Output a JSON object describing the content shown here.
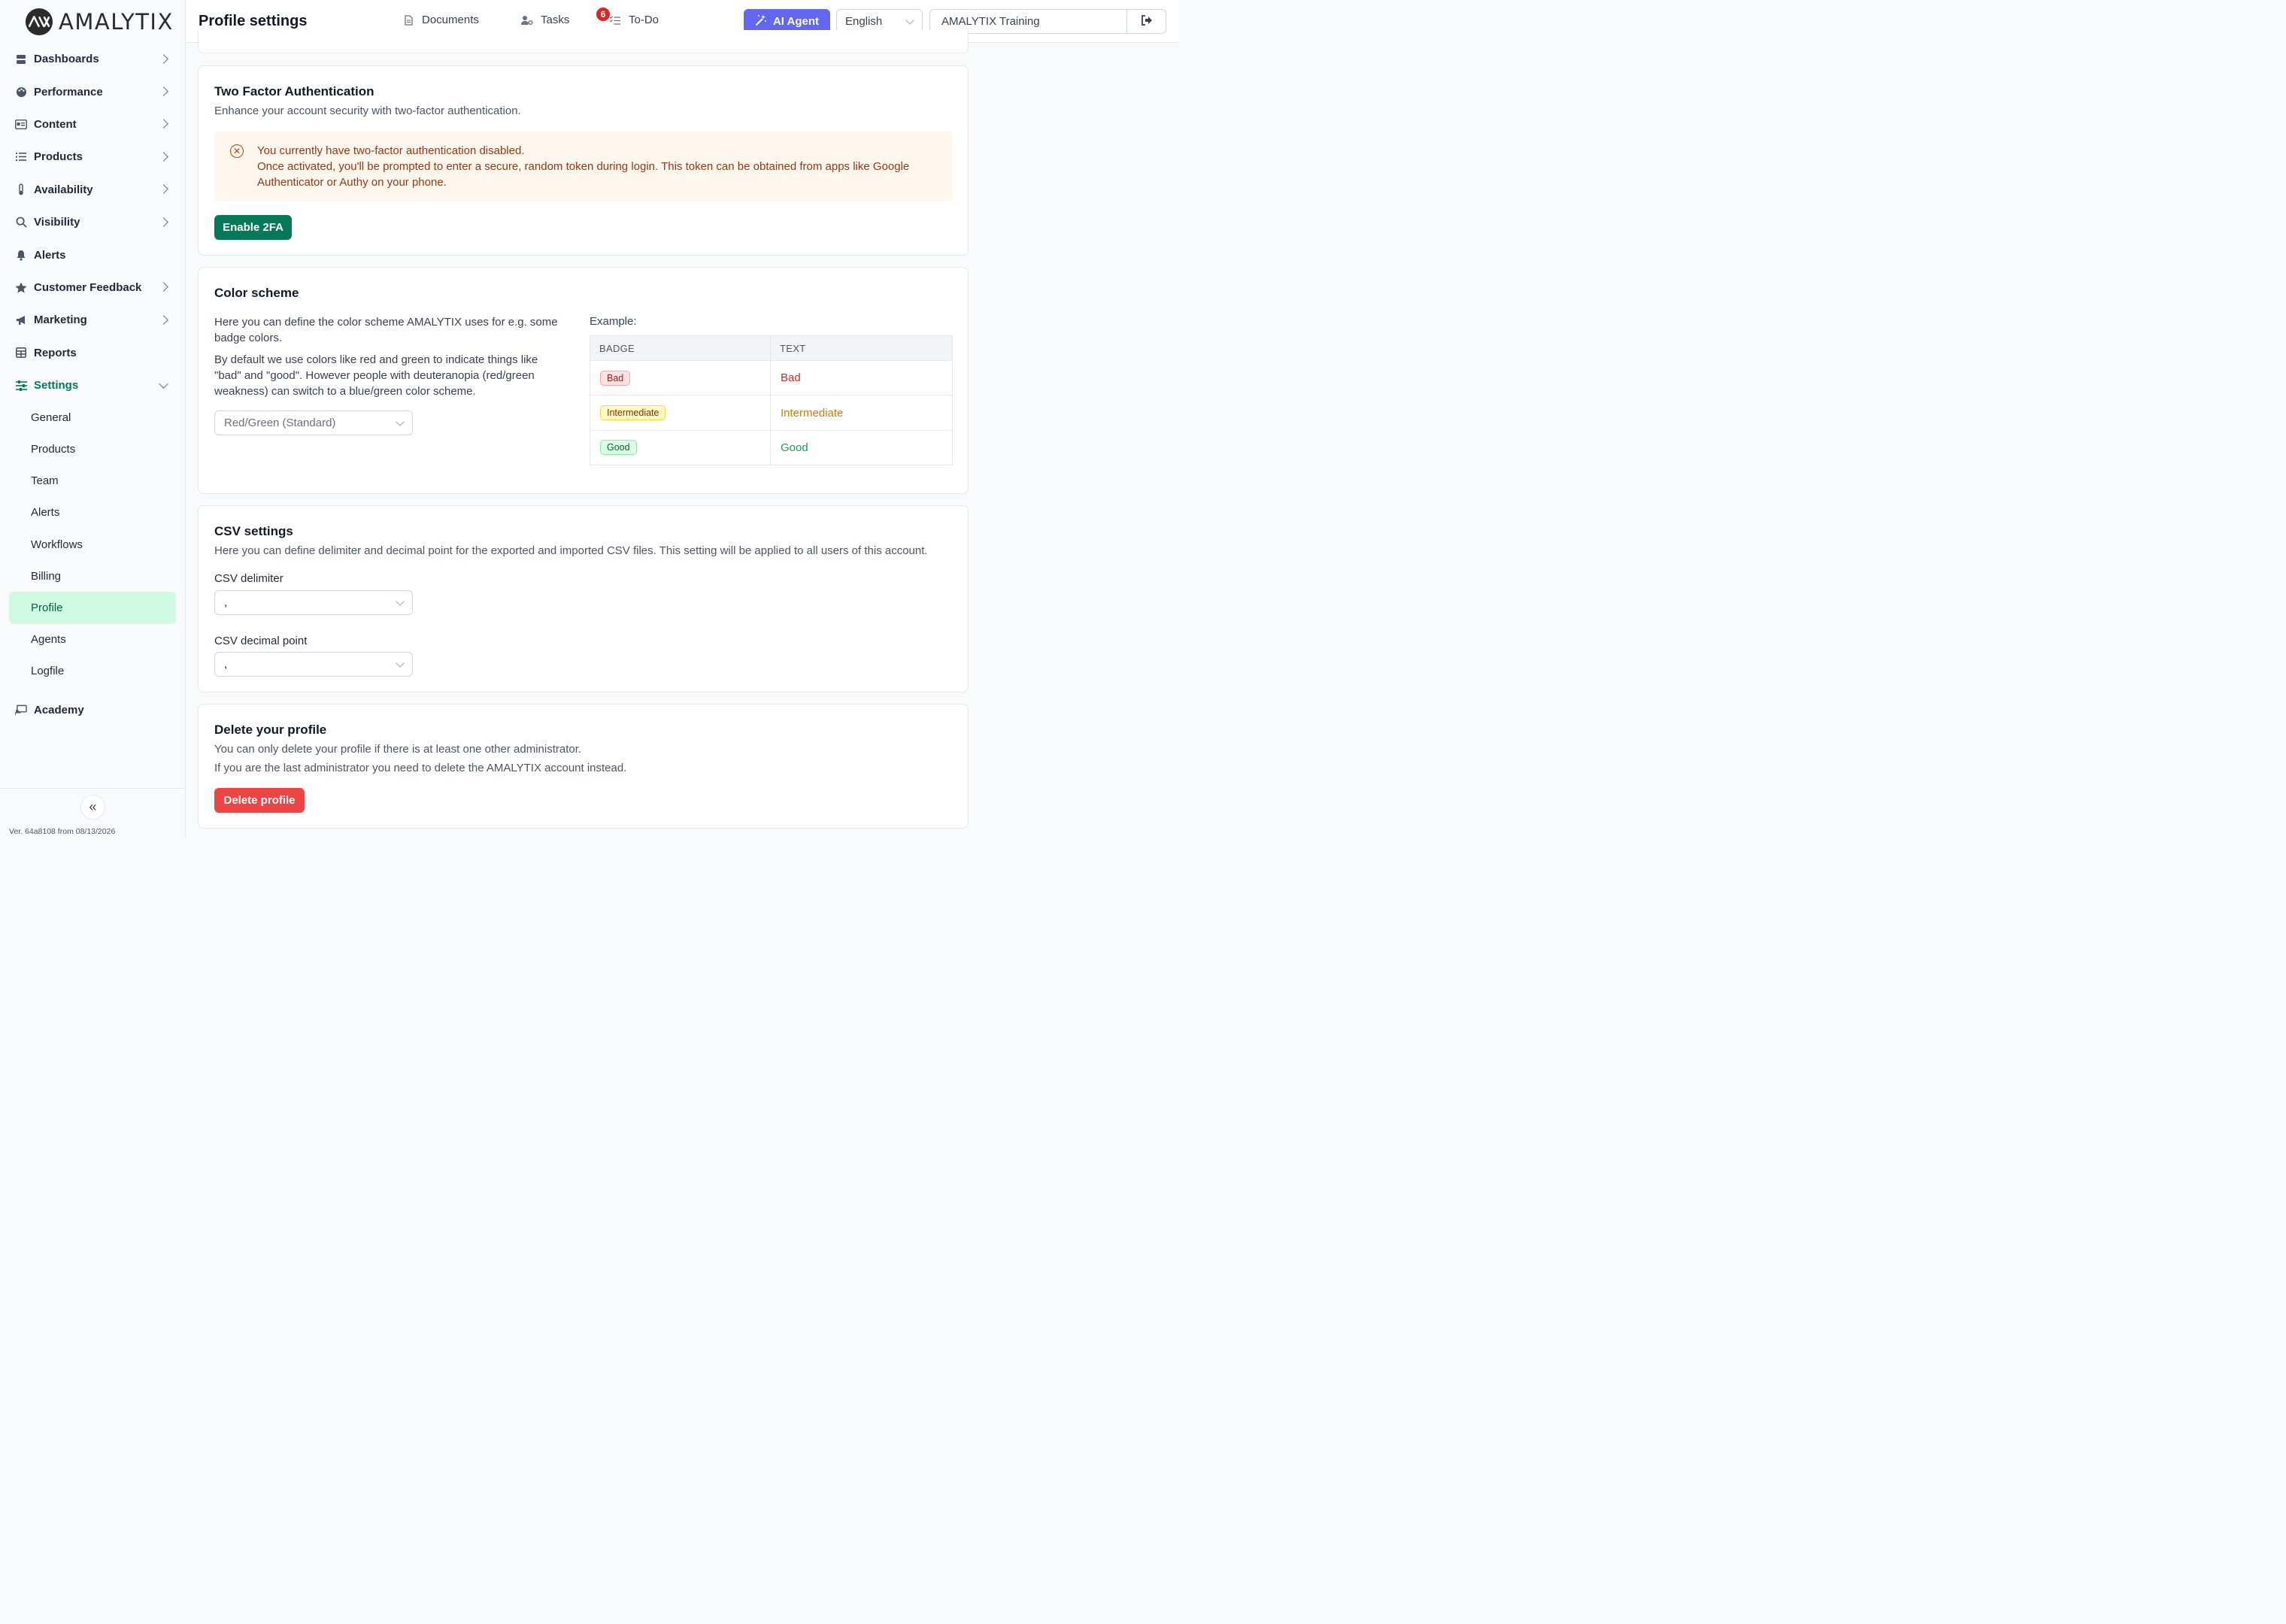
{
  "brand": {
    "name": "AMALYTIX"
  },
  "sidebar": {
    "items": [
      {
        "label": "Dashboards",
        "icon": "server-icon"
      },
      {
        "label": "Performance",
        "icon": "palette-icon"
      },
      {
        "label": "Content",
        "icon": "id-card-icon"
      },
      {
        "label": "Products",
        "icon": "list-icon"
      },
      {
        "label": "Availability",
        "icon": "thermometer-icon"
      },
      {
        "label": "Visibility",
        "icon": "search-icon"
      },
      {
        "label": "Alerts",
        "icon": "bell-icon"
      },
      {
        "label": "Customer Feedback",
        "icon": "star-icon"
      },
      {
        "label": "Marketing",
        "icon": "megaphone-icon"
      },
      {
        "label": "Reports",
        "icon": "table-icon"
      },
      {
        "label": "Settings",
        "icon": "sliders-icon"
      }
    ],
    "settings_sub": [
      "General",
      "Products",
      "Team",
      "Alerts",
      "Workflows",
      "Billing",
      "Profile",
      "Agents",
      "Logfile"
    ],
    "academy": "Academy",
    "version": "Ver. 64a8108 from 08/13/2026"
  },
  "header": {
    "title": "Profile settings",
    "documents": "Documents",
    "documents_count": "6",
    "tasks": "Tasks",
    "todo": "To-Do",
    "more": "•••",
    "ai_agent": "AI Agent",
    "language": "English",
    "account": "AMALYTIX Training"
  },
  "two_factor": {
    "title": "Two Factor Authentication",
    "subtitle": "Enhance your account security with two-factor authentication.",
    "alert_line1": "You currently have two-factor authentication disabled.",
    "alert_line2": "Once activated, you'll be prompted to enter a secure, random token during login. This token can be obtained from apps like Google Authenticator or Authy on your phone.",
    "button": "Enable 2FA"
  },
  "color_scheme": {
    "title": "Color scheme",
    "para1": "Here you can define the color scheme AMALYTIX uses for e.g. some badge colors.",
    "para2": "By default we use colors like red and green to indicate things like \"bad\" and \"good\". However people with deuteranopia (red/green weakness) can switch to a blue/green color scheme.",
    "selected": "Red/Green (Standard)",
    "example_label": "Example:",
    "col_badge": "BADGE",
    "col_text": "TEXT",
    "rows": [
      {
        "badge": "Bad",
        "text": "Bad",
        "color": "#dc2626"
      },
      {
        "badge": "Intermediate",
        "text": "Intermediate",
        "color": "#d97706"
      },
      {
        "badge": "Good",
        "text": "Good",
        "color": "#16a34a"
      }
    ]
  },
  "csv": {
    "title": "CSV settings",
    "subtitle": "Here you can define delimiter and decimal point for the exported and imported CSV files. This setting will be applied to all users of this account.",
    "delimiter_label": "CSV delimiter",
    "delimiter_value": ",",
    "decimal_label": "CSV decimal point",
    "decimal_value": ","
  },
  "delete": {
    "title": "Delete your profile",
    "line1": "You can only delete your profile if there is at least one other administrator.",
    "line2": "If you are the last administrator you need to delete the AMALYTIX account instead.",
    "button": "Delete profile"
  },
  "colors": {
    "accent": "#047857",
    "ai": "#6366f1",
    "danger": "#ef4444",
    "warning_bg": "#fff7ed"
  }
}
